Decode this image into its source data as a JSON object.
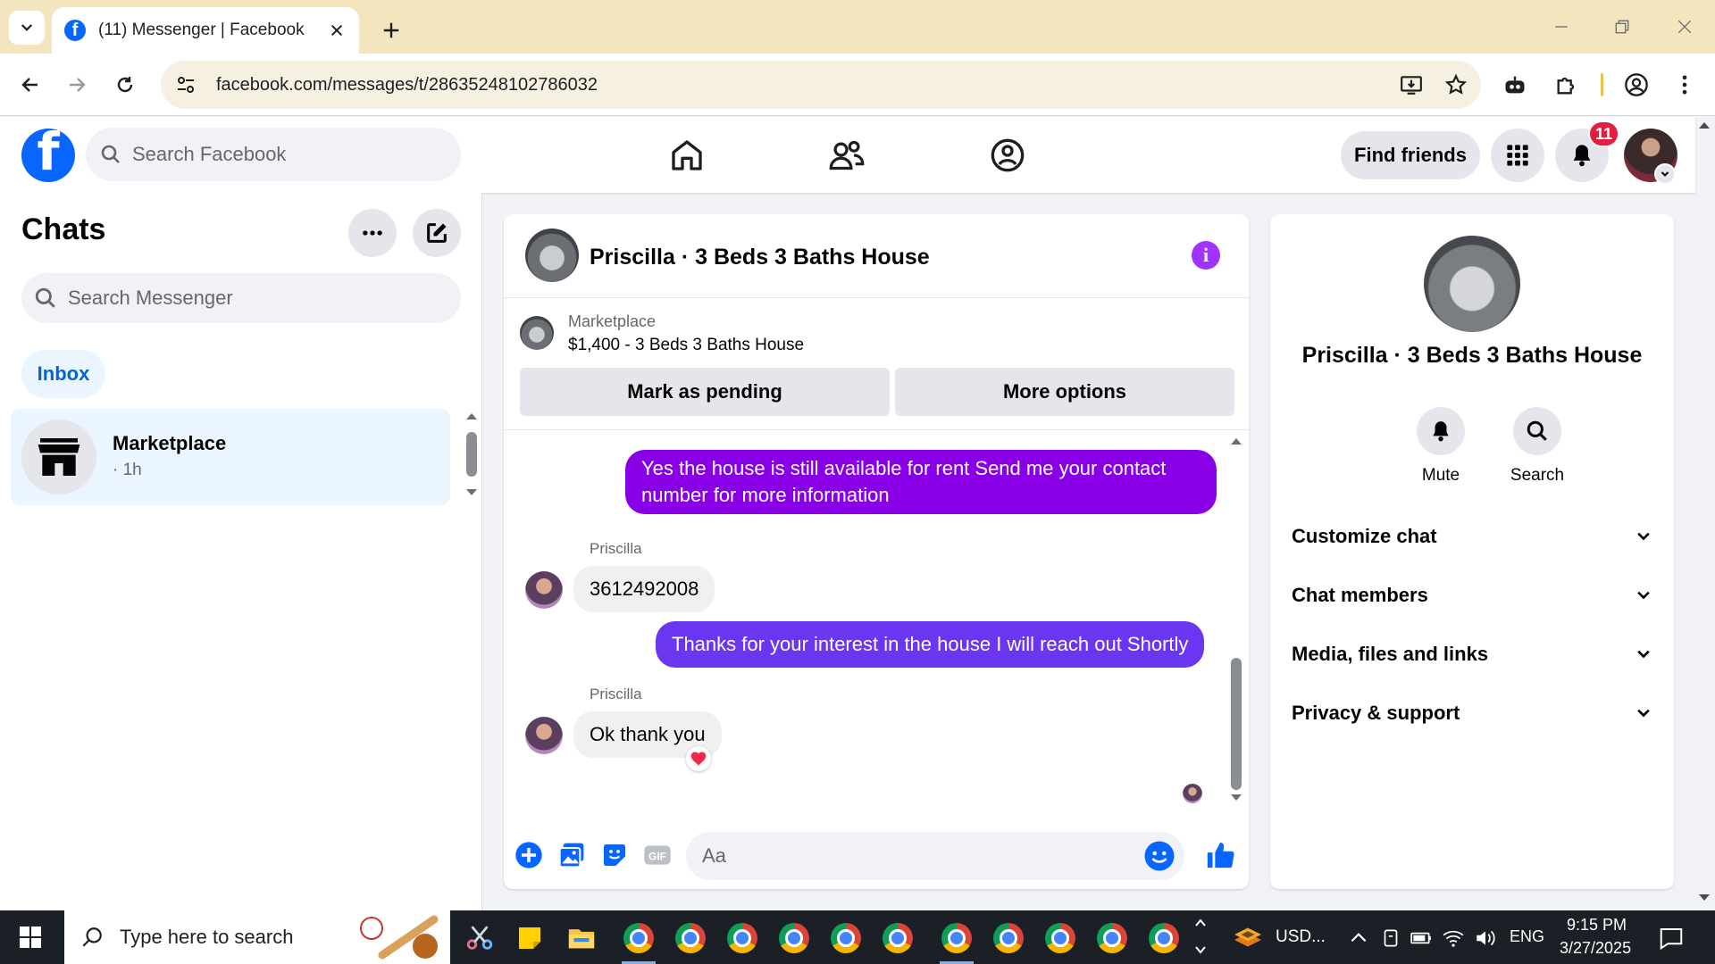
{
  "browser": {
    "tab_title": "(11) Messenger | Facebook",
    "url": "facebook.com/messages/t/28635248102786032"
  },
  "fb": {
    "search_placeholder": "Search Facebook",
    "find_friends": "Find friends",
    "notification_count": "11"
  },
  "sidebar": {
    "title": "Chats",
    "search_placeholder": "Search Messenger",
    "filter": "Inbox",
    "chats": [
      {
        "name": "Marketplace",
        "time": "· 1h",
        "icon": "shop-icon"
      }
    ]
  },
  "chat": {
    "title": "Priscilla · 3 Beds 3 Baths House",
    "marketplace_label": "Marketplace",
    "listing": "$1,400 - 3 Beds 3 Baths House",
    "mark_pending": "Mark as pending",
    "more_options": "More options",
    "messages": [
      {
        "from": "me",
        "text": "Yes the house is still available for rent Send me your contact number for more information",
        "color": "#8a00e6"
      },
      {
        "from": "Priscilla",
        "text": "3612492008"
      },
      {
        "from": "me",
        "text": "Thanks for your interest in the house I will reach out Shortly",
        "color": "#6b36f0"
      },
      {
        "from": "Priscilla",
        "text": "Ok thank you",
        "reaction": "heart"
      }
    ],
    "composer_placeholder": "Aa"
  },
  "info": {
    "name": "Priscilla · 3 Beds 3 Baths House",
    "actions": [
      "Mute",
      "Search"
    ],
    "sections": [
      "Customize chat",
      "Chat members",
      "Media, files and links",
      "Privacy & support"
    ]
  },
  "taskbar": {
    "search_placeholder": "Type here to search",
    "currency": "USD...",
    "lang": "ENG",
    "time": "9:15 PM",
    "date": "3/27/2025"
  },
  "colors": {
    "fb_blue": "#0866ff",
    "accent_purple": "#a033ff",
    "badge_red": "#e41e3f"
  }
}
